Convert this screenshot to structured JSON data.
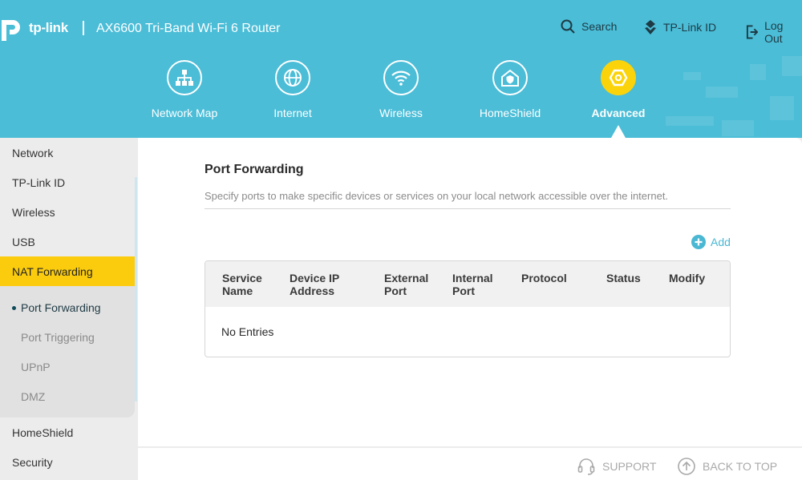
{
  "header": {
    "logo_text": "tp-link",
    "product_name": "AX6600 Tri-Band Wi-Fi 6 Router",
    "utilities": {
      "search": "Search",
      "tplink_id": "TP-Link ID",
      "logout": "Log Out"
    }
  },
  "nav": {
    "tabs": [
      {
        "label": "Network Map",
        "icon": "network-map-icon"
      },
      {
        "label": "Internet",
        "icon": "globe-icon"
      },
      {
        "label": "Wireless",
        "icon": "wifi-icon"
      },
      {
        "label": "HomeShield",
        "icon": "home-shield-icon"
      },
      {
        "label": "Advanced",
        "icon": "gear-icon",
        "active": true
      }
    ]
  },
  "sidebar": {
    "items": [
      {
        "label": "Network"
      },
      {
        "label": "TP-Link ID"
      },
      {
        "label": "Wireless"
      },
      {
        "label": "USB"
      },
      {
        "label": "NAT Forwarding",
        "active": true
      },
      {
        "label": "HomeShield"
      },
      {
        "label": "Security"
      }
    ],
    "subitems": [
      {
        "label": "Port Forwarding",
        "current": true
      },
      {
        "label": "Port Triggering"
      },
      {
        "label": "UPnP"
      },
      {
        "label": "DMZ"
      }
    ]
  },
  "main": {
    "title": "Port Forwarding",
    "description": "Specify ports to make specific devices or services on your local network accessible over the internet.",
    "add_label": "Add",
    "table": {
      "columns": [
        [
          "Service",
          "Name"
        ],
        [
          "Device IP",
          "Address"
        ],
        [
          "External",
          "Port"
        ],
        [
          "Internal",
          "Port"
        ],
        [
          "Protocol"
        ],
        [
          "Status"
        ],
        [
          "Modify"
        ]
      ],
      "empty_text": "No Entries"
    }
  },
  "footer": {
    "support": "SUPPORT",
    "back_to_top": "BACK TO TOP"
  },
  "colors": {
    "header_bg": "#4bbdd7",
    "accent_yellow": "#fbcc0e",
    "link_blue": "#4ab7d3"
  }
}
